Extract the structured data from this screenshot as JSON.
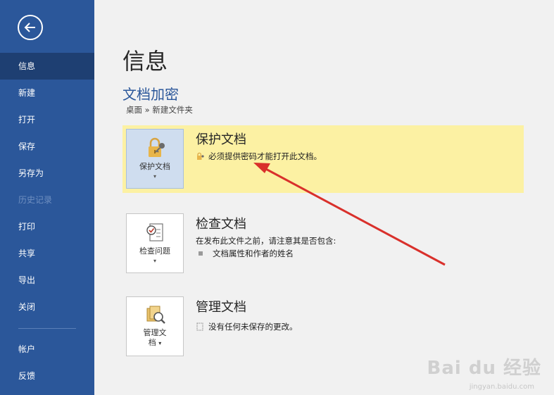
{
  "sidebar": {
    "items": [
      {
        "label": "信息"
      },
      {
        "label": "新建"
      },
      {
        "label": "打开"
      },
      {
        "label": "保存"
      },
      {
        "label": "另存为"
      },
      {
        "label": "历史记录"
      },
      {
        "label": "打印"
      },
      {
        "label": "共享"
      },
      {
        "label": "导出"
      },
      {
        "label": "关闭"
      },
      {
        "label": "帐户"
      },
      {
        "label": "反馈"
      }
    ]
  },
  "main": {
    "title": "信息",
    "doc_title": "文档加密",
    "doc_path": "桌面 » 新建文件夹",
    "sections": [
      {
        "tile_label": "保护文档",
        "heading": "保护文档",
        "description": "必须提供密码才能打开此文档。"
      },
      {
        "tile_label": "检查问题",
        "heading": "检查文档",
        "description": "在发布此文件之前，请注意其是否包含:",
        "bullet": "文档属性和作者的姓名"
      },
      {
        "tile_label_1": "管理文",
        "tile_label_2": "档",
        "heading": "管理文档",
        "description": "没有任何未保存的更改。"
      }
    ]
  },
  "watermark": {
    "text": "Bai du 经验",
    "sub": "jingyan.baidu.com"
  },
  "colors": {
    "sidebar": "#2b579a",
    "sidebar_active": "#1e3f72",
    "highlight": "#fcf1a3",
    "arrow": "#d9302b"
  }
}
